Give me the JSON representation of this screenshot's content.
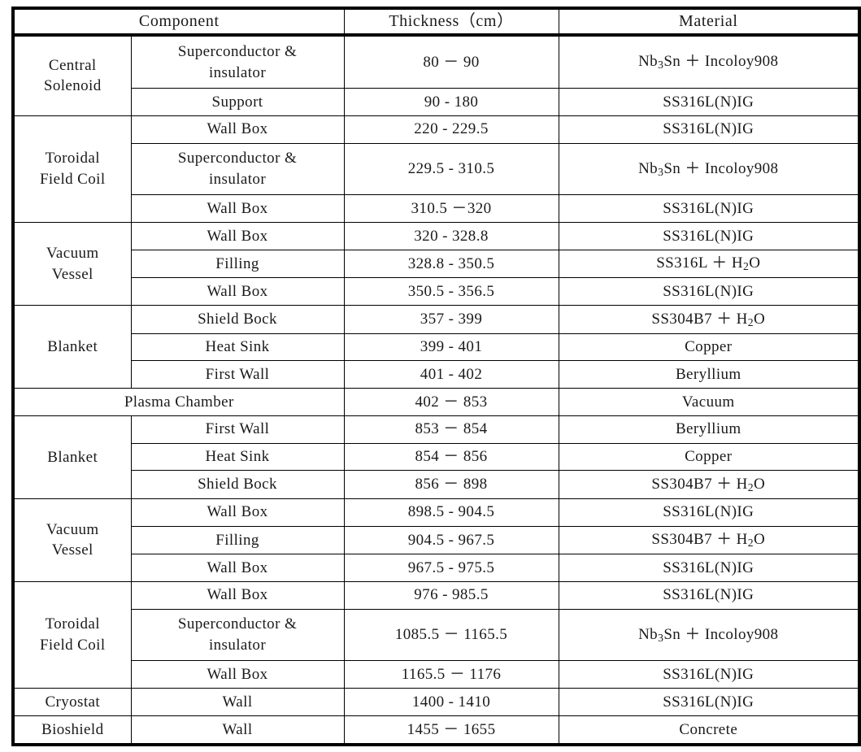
{
  "table": {
    "headers": {
      "component": "Component",
      "thickness": "Thickness（cm）",
      "material": "Material"
    },
    "groups": [
      {
        "name": "Central\nSolenoid",
        "name_lines": [
          "Central",
          "Solenoid"
        ],
        "rows": [
          {
            "part_lines": [
              "Superconductor  &",
              "insulator"
            ],
            "part": "Superconductor & insulator",
            "thickness": "80 － 90",
            "material_pre": "Nb",
            "material_sub": "3",
            "material_post": "Sn ＋ Incoloy908",
            "material": "Nb3Sn + Incoloy908"
          },
          {
            "part": "Support",
            "thickness": "90 - 180",
            "material": "SS316L(N)IG"
          }
        ]
      },
      {
        "name_lines": [
          "Toroidal",
          "Field Coil"
        ],
        "name": "Toroidal Field Coil",
        "rows": [
          {
            "part": "Wall Box",
            "thickness": "220 - 229.5",
            "material": "SS316L(N)IG"
          },
          {
            "part_lines": [
              "Superconductor  &",
              "insulator"
            ],
            "part": "Superconductor & insulator",
            "thickness": "229.5 - 310.5",
            "material_pre": "Nb",
            "material_sub": "3",
            "material_post": "Sn ＋ Incoloy908",
            "material": "Nb3Sn + Incoloy908"
          },
          {
            "part": "Wall Box",
            "thickness": "310.5 －320",
            "material": "SS316L(N)IG"
          }
        ]
      },
      {
        "name_lines": [
          "Vacuum",
          "Vessel"
        ],
        "name": "Vacuum Vessel",
        "rows": [
          {
            "part": "Wall Box",
            "thickness": "320 - 328.8",
            "material": "SS316L(N)IG"
          },
          {
            "part": "Filling",
            "thickness": "328.8 - 350.5",
            "material_pre": "SS316L ＋ H",
            "material_sub": "2",
            "material_post": "O",
            "material": "SS316L + H2O"
          },
          {
            "part": "Wall Box",
            "thickness": "350.5 - 356.5",
            "material": "SS316L(N)IG"
          }
        ]
      },
      {
        "name_lines": [
          "Blanket"
        ],
        "name": "Blanket",
        "rows": [
          {
            "part": "Shield Bock",
            "thickness": "357 - 399",
            "material_pre": "SS304B7 ＋ H",
            "material_sub": "2",
            "material_post": "O",
            "material": "SS304B7 + H2O"
          },
          {
            "part": "Heat Sink",
            "thickness": "399 - 401",
            "material": "Copper"
          },
          {
            "part": "First Wall",
            "thickness": "401 - 402",
            "material": "Beryllium"
          }
        ]
      },
      {
        "full_width_row": true,
        "name": "Plasma Chamber",
        "rows": [
          {
            "part": "Plasma Chamber",
            "thickness": "402 － 853",
            "material": "Vacuum"
          }
        ]
      },
      {
        "name_lines": [
          "Blanket"
        ],
        "name": "Blanket",
        "rows": [
          {
            "part": "First Wall",
            "thickness": "853 － 854",
            "material": "Beryllium"
          },
          {
            "part": "Heat Sink",
            "thickness": "854 － 856",
            "material": "Copper"
          },
          {
            "part": "Shield Bock",
            "thickness": "856 － 898",
            "material_pre": "SS304B7 ＋ H",
            "material_sub": "2",
            "material_post": "O",
            "material": "SS304B7 + H2O"
          }
        ]
      },
      {
        "name_lines": [
          "Vacuum",
          "Vessel"
        ],
        "name": "Vacuum Vessel",
        "rows": [
          {
            "part": "Wall Box",
            "thickness": "898.5 - 904.5",
            "material": "SS316L(N)IG"
          },
          {
            "part": "Filling",
            "thickness": "904.5 - 967.5",
            "material_pre": "SS304B7 ＋ H",
            "material_sub": "2",
            "material_post": "O",
            "material": "SS304B7 + H2O"
          },
          {
            "part": "Wall Box",
            "thickness": "967.5 - 975.5",
            "material": "SS316L(N)IG"
          }
        ]
      },
      {
        "name_lines": [
          "Toroidal",
          "Field Coil"
        ],
        "name": "Toroidal Field Coil",
        "rows": [
          {
            "part": "Wall Box",
            "thickness": "976 - 985.5",
            "material": "SS316L(N)IG"
          },
          {
            "part_lines": [
              "Superconductor  &",
              "insulator"
            ],
            "part": "Superconductor & insulator",
            "thickness": "1085.5 － 1165.5",
            "material_pre": "Nb",
            "material_sub": "3",
            "material_post": "Sn ＋ Incoloy908",
            "material": "Nb3Sn + Incoloy908"
          },
          {
            "part": "Wall Box",
            "thickness": "1165.5 － 1176",
            "material": "SS316L(N)IG"
          }
        ]
      },
      {
        "name_lines": [
          "Cryostat"
        ],
        "name": "Cryostat",
        "rows": [
          {
            "part": "Wall",
            "thickness": "1400 - 1410",
            "material": "SS316L(N)IG"
          }
        ]
      },
      {
        "name_lines": [
          "Bioshield"
        ],
        "name": "Bioshield",
        "rows": [
          {
            "part": "Wall",
            "thickness": "1455 － 1655",
            "material": "Concrete"
          }
        ]
      }
    ]
  }
}
